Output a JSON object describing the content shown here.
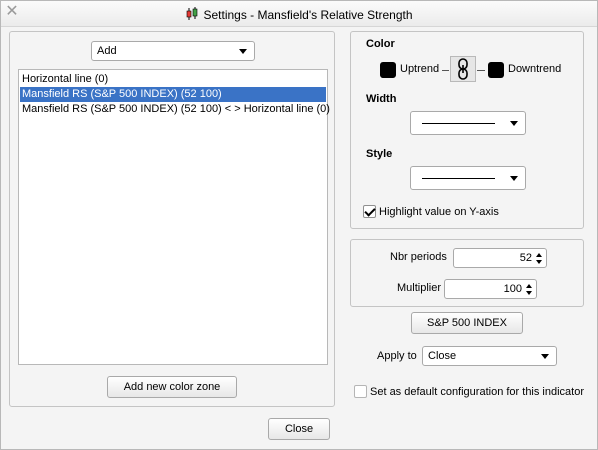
{
  "window": {
    "title": "Settings - Mansfield's Relative Strength"
  },
  "left": {
    "add_combo": {
      "value": "Add"
    },
    "list_items": [
      {
        "label": "Horizontal line (0)",
        "selected": false
      },
      {
        "label": "Mansfield RS (S&P 500 INDEX) (52 100)",
        "selected": true
      },
      {
        "label": "Mansfield RS (S&P 500 INDEX) (52 100) < > Horizontal line (0)",
        "selected": false
      }
    ],
    "add_zone_label": "Add new color zone"
  },
  "style_panel": {
    "color_label": "Color",
    "uptrend_label": "Uptrend",
    "downtrend_label": "Downtrend",
    "uptrend_color": "#000000",
    "downtrend_color": "#000000",
    "link_icon": "chain-link-icon",
    "width_label": "Width",
    "style_label": "Style",
    "highlight_label": "Highlight value on Y-axis",
    "highlight_checked": true
  },
  "params": {
    "periods_label": "Nbr periods",
    "periods_value": "52",
    "multiplier_label": "Multiplier",
    "multiplier_value": "100"
  },
  "index_button": "S&P 500 INDEX",
  "apply_to": {
    "label": "Apply to",
    "value": "Close"
  },
  "default_config": {
    "label": "Set as default configuration for this indicator",
    "checked": false
  },
  "close_button": "Close",
  "colors": {
    "selection": "#3a73c6",
    "panel_bg": "#f4f4f4"
  }
}
